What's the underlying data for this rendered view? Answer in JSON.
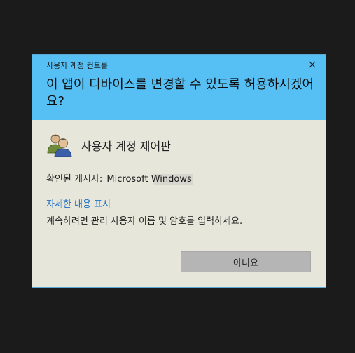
{
  "dialog": {
    "window_title": "사용자 계정 컨트롤",
    "question": "이 앱이 디바이스를 변경할 수 있도록 허용하시겠어요?",
    "app_name": "사용자 계정 제어판",
    "publisher_label": "확인된 게시자:",
    "publisher_value": "Microsoft Windows",
    "details_link": "자세한 내용 표시",
    "instruction": "계속하려면 관리 사용자 이름 및 암호를 입력하세요.",
    "no_button": "아니요",
    "header_color": "#56c0f5",
    "body_color": "#e6e6db",
    "link_color": "#1a6fc4",
    "icons": {
      "close": "close-icon",
      "app": "users-icon"
    }
  }
}
